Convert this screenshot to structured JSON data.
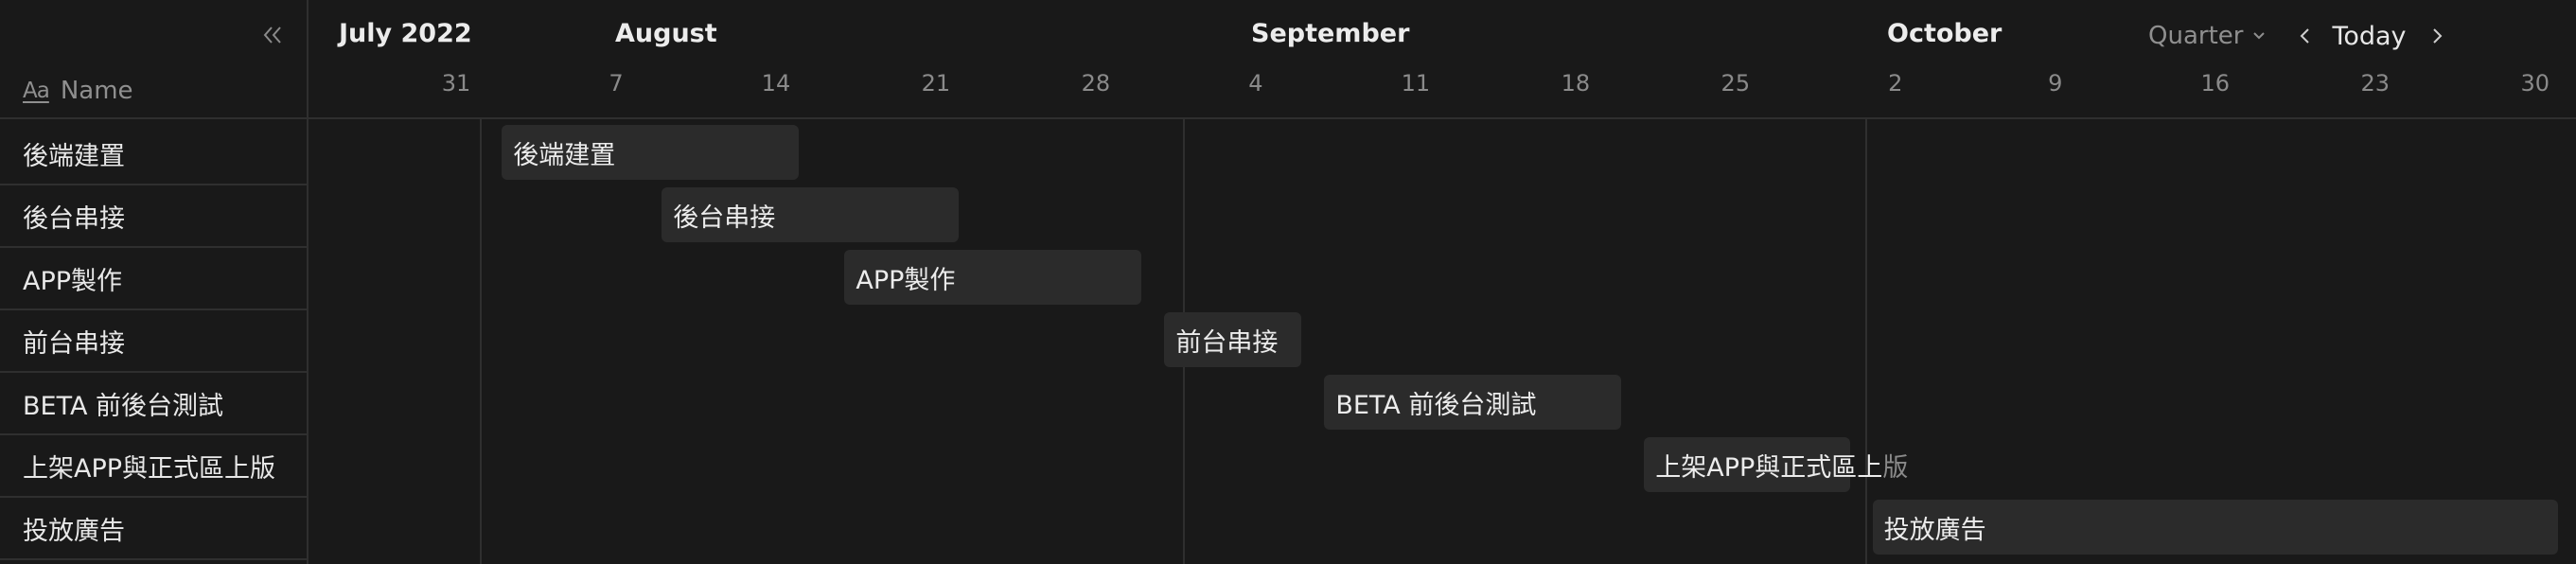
{
  "sidebar": {
    "name_header": {
      "icon_text": "Aa",
      "label": "Name"
    },
    "rows": [
      {
        "label": "後端建置"
      },
      {
        "label": "後台串接"
      },
      {
        "label": "APP製作"
      },
      {
        "label": "前台串接"
      },
      {
        "label": "BETA 前後台測試"
      },
      {
        "label": "上架APP與正式區上版"
      },
      {
        "label": "投放廣告"
      }
    ]
  },
  "timeline": {
    "months": [
      {
        "label": "July 2022"
      },
      {
        "label": "August"
      },
      {
        "label": "September"
      },
      {
        "label": "October"
      }
    ],
    "days": [
      "31",
      "7",
      "14",
      "21",
      "28",
      "4",
      "11",
      "18",
      "25",
      "2",
      "9",
      "16",
      "23",
      "30"
    ],
    "bars": [
      {
        "label": "後端建置",
        "start": "2022-08-02",
        "end": "2022-08-15"
      },
      {
        "label": "後台串接",
        "start": "2022-08-09",
        "end": "2022-08-22"
      },
      {
        "label": "APP製作",
        "start": "2022-08-17",
        "end": "2022-08-30"
      },
      {
        "label": "前台串接",
        "start": "2022-08-31",
        "end": "2022-09-06"
      },
      {
        "label": "BETA 前後台測試",
        "start": "2022-09-07",
        "end": "2022-09-20"
      },
      {
        "label": "上架APP與正式區上",
        "label_overflow": "版",
        "start": "2022-09-21",
        "end": "2022-09-30"
      },
      {
        "label": "投放廣告",
        "start": "2022-10-01",
        "end": "2022-10-31"
      }
    ]
  },
  "controls": {
    "view_select": "Quarter",
    "today_label": "Today"
  },
  "colors": {
    "background": "#191919",
    "bar": "#2b2b2b",
    "divider": "#2f2f2f",
    "text": "#ececec",
    "muted": "#8a8a8a"
  }
}
